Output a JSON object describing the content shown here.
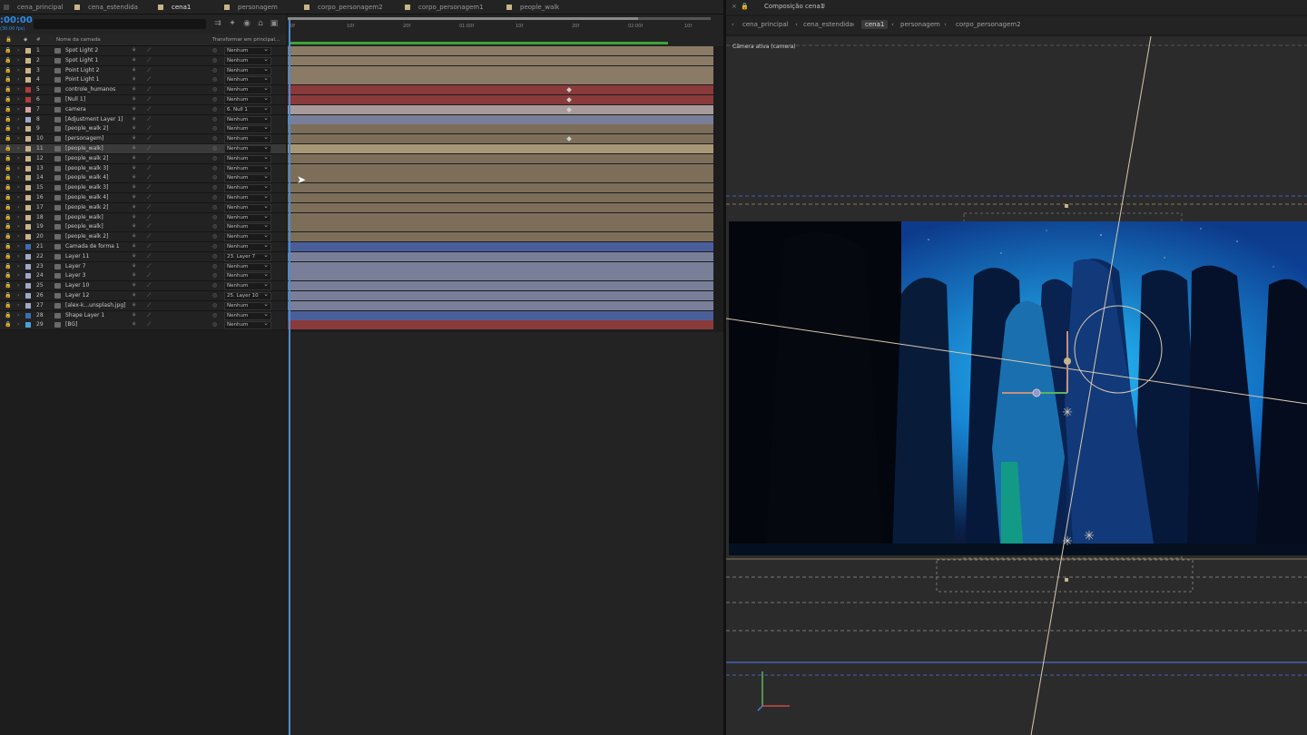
{
  "tabs": [
    {
      "label": "cena_principal",
      "color": "#4a4a4a"
    },
    {
      "label": "cena_estendida",
      "color": "#c8b48a"
    },
    {
      "label": "cena1",
      "color": "#c8b48a",
      "active": true
    },
    {
      "label": "personagem",
      "color": "#c8b48a"
    },
    {
      "label": "corpo_personagem2",
      "color": "#c8b48a"
    },
    {
      "label": "corpo_personagem1",
      "color": "#c8b48a"
    },
    {
      "label": "people_walk",
      "color": "#c8b48a"
    }
  ],
  "timeline": {
    "timecode": ":00:00",
    "fps": "(30.00 fps)",
    "columns": {
      "hash": "#",
      "name": "Nome da camada",
      "parent": "Transformar em principal..."
    },
    "ruler": [
      "0f",
      "10f",
      "20f",
      "01:00f",
      "10f",
      "20f",
      "02:00f",
      "10f"
    ]
  },
  "layers": [
    {
      "num": "1",
      "name": "Spot Light 2",
      "label": "#c8b48a",
      "parent": "Nenhum",
      "bar": "#8a7a66"
    },
    {
      "num": "2",
      "name": "Spot Light 1",
      "label": "#c8b48a",
      "parent": "Nenhum",
      "bar": "#8a7a66"
    },
    {
      "num": "3",
      "name": "Point Light 2",
      "label": "#c8b48a",
      "parent": "Nenhum",
      "bar": "#8a7a66"
    },
    {
      "num": "4",
      "name": "Point Light 1",
      "label": "#c8b48a",
      "parent": "Nenhum",
      "bar": "#8a7a66"
    },
    {
      "num": "5",
      "name": "controle_humanos",
      "label": "#b33b3b",
      "parent": "Nenhum",
      "bar": "#8a3a3a",
      "kf": 0.66
    },
    {
      "num": "6",
      "name": "[Null 1]",
      "label": "#b33b3b",
      "parent": "Nenhum",
      "bar": "#8a3a3a",
      "kf": 0.66
    },
    {
      "num": "7",
      "name": "camera",
      "label": "#d9a0a0",
      "parent": "6. Null 1",
      "bar": "#a89a9a",
      "kf": 0.66
    },
    {
      "num": "8",
      "name": "[Adjustment Layer 1]",
      "label": "#a0a8c8",
      "parent": "Nenhum",
      "bar": "#7a7f99"
    },
    {
      "num": "9",
      "name": "[people_walk 2]",
      "label": "#c8b48a",
      "parent": "Nenhum",
      "bar": "#7d6e5a"
    },
    {
      "num": "10",
      "name": "[personagem]",
      "label": "#c8b48a",
      "parent": "Nenhum",
      "bar": "#7d6e5a",
      "kf": 0.66
    },
    {
      "num": "11",
      "name": "[people_walk]",
      "label": "#c8b48a",
      "parent": "Nenhum",
      "bar": "#a89776",
      "selected": true
    },
    {
      "num": "12",
      "name": "[people_walk 2]",
      "label": "#c8b48a",
      "parent": "Nenhum",
      "bar": "#7d6e5a"
    },
    {
      "num": "13",
      "name": "[people_walk 3]",
      "label": "#c8b48a",
      "parent": "Nenhum",
      "bar": "#7d6e5a"
    },
    {
      "num": "14",
      "name": "[people_walk 4]",
      "label": "#c8b48a",
      "parent": "Nenhum",
      "bar": "#7d6e5a"
    },
    {
      "num": "15",
      "name": "[people_walk 3]",
      "label": "#c8b48a",
      "parent": "Nenhum",
      "bar": "#7d6e5a"
    },
    {
      "num": "16",
      "name": "[people_walk 4]",
      "label": "#c8b48a",
      "parent": "Nenhum",
      "bar": "#7d6e5a"
    },
    {
      "num": "17",
      "name": "[people_walk 2]",
      "label": "#c8b48a",
      "parent": "Nenhum",
      "bar": "#7d6e5a"
    },
    {
      "num": "18",
      "name": "[people_walk]",
      "label": "#c8b48a",
      "parent": "Nenhum",
      "bar": "#7d6e5a"
    },
    {
      "num": "19",
      "name": "[people_walk]",
      "label": "#c8b48a",
      "parent": "Nenhum",
      "bar": "#7d6e5a"
    },
    {
      "num": "20",
      "name": "[people_walk 2]",
      "label": "#c8b48a",
      "parent": "Nenhum",
      "bar": "#7d6e5a"
    },
    {
      "num": "21",
      "name": "Camada de forma 1",
      "label": "#3a6fb3",
      "parent": "Nenhum",
      "bar": "#4a5f99"
    },
    {
      "num": "22",
      "name": "Layer 11",
      "label": "#a0a8c8",
      "parent": "23. Layer 7",
      "bar": "#7a7f99"
    },
    {
      "num": "23",
      "name": "Layer 7",
      "label": "#a0a8c8",
      "parent": "Nenhum",
      "bar": "#7a7f99"
    },
    {
      "num": "24",
      "name": "Layer 3",
      "label": "#a0a8c8",
      "parent": "Nenhum",
      "bar": "#7a7f99"
    },
    {
      "num": "25",
      "name": "Layer 10",
      "label": "#a0a8c8",
      "parent": "Nenhum",
      "bar": "#7a7f99"
    },
    {
      "num": "26",
      "name": "Layer 12",
      "label": "#a0a8c8",
      "parent": "25. Layer 10",
      "bar": "#7a7f99"
    },
    {
      "num": "27",
      "name": "[alex-k...unsplash.jpg]",
      "label": "#a0a8c8",
      "parent": "Nenhum",
      "bar": "#7a7f99"
    },
    {
      "num": "28",
      "name": "Shape Layer 1",
      "label": "#3a6fb3",
      "parent": "Nenhum",
      "bar": "#4a5f99"
    },
    {
      "num": "29",
      "name": "[BG]",
      "label": "#4aa0d9",
      "parent": "Nenhum",
      "bar": "#8a3a3a"
    }
  ],
  "comp": {
    "panel_title": "Composição cena1",
    "camera_label": "Câmera ativa (camera)",
    "breadcrumbs": [
      "cena_principal",
      "cena_estendida",
      "cena1",
      "personagem",
      "corpo_personagem2"
    ]
  }
}
